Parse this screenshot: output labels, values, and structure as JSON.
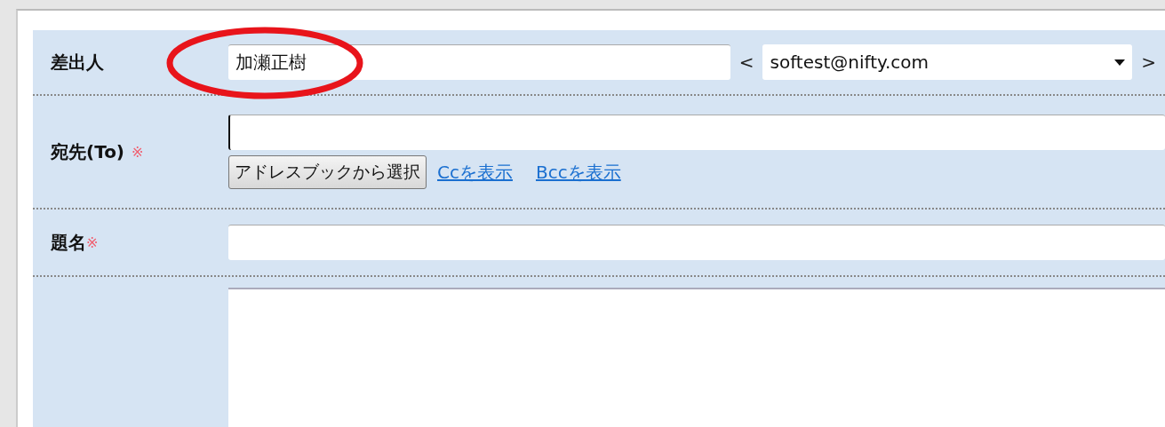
{
  "sender": {
    "label": "差出人",
    "name_value": "加瀬正樹",
    "open_bracket": "<",
    "address_value": "softest@nifty.com",
    "close_bracket": ">"
  },
  "to": {
    "label": "宛先(To)",
    "required_mark": "※",
    "address_book_button": "アドレスブックから選択",
    "links": [
      {
        "label": "Ccを表示"
      },
      {
        "label": "Bccを表示"
      }
    ]
  },
  "subject": {
    "label": "題名",
    "required_mark": "※"
  }
}
